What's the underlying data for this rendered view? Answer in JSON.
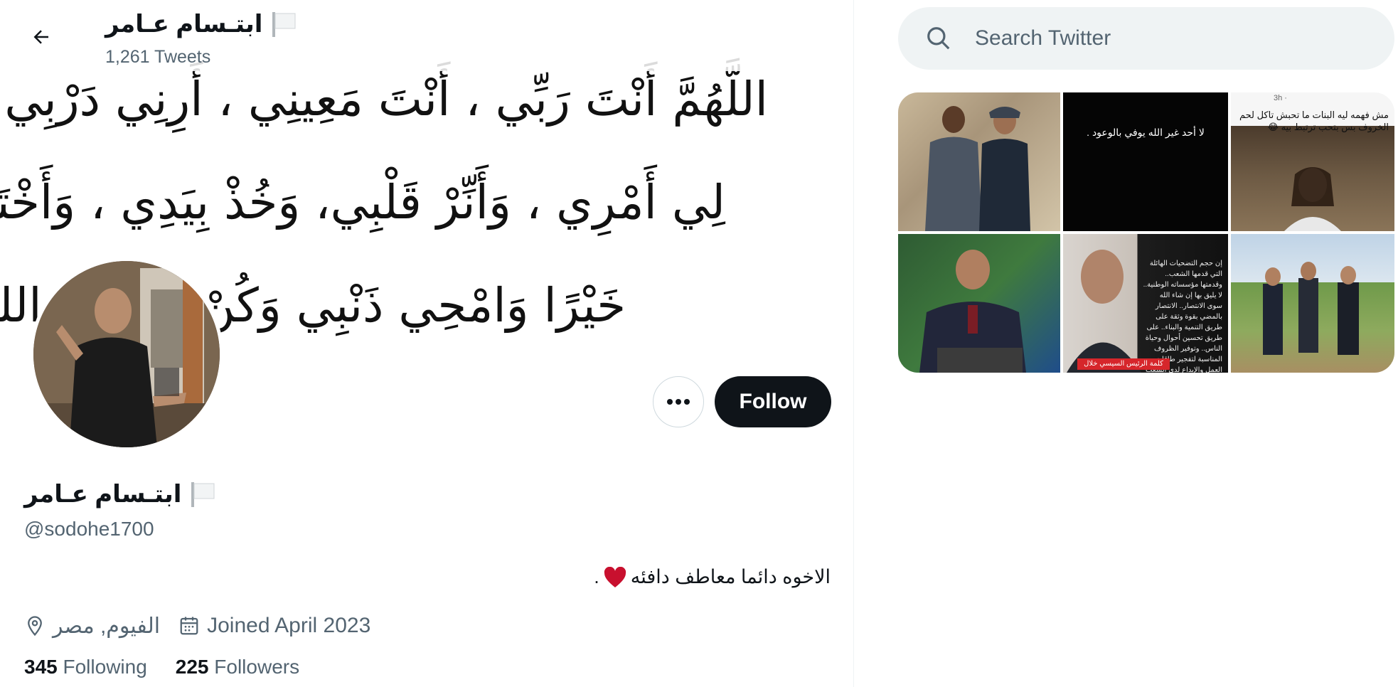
{
  "header": {
    "name": "ابتـسام عـامر",
    "tweet_count": "1,261 Tweets"
  },
  "banner": {
    "lines": [
      "اللَّهُمَّ أَنْتَ رَبِّي ، أَنْتَ مَعِينِي ، أَرِنِي دَرْبِي ، وَيَسِّرْ",
      "لِي أَمْرِي ، وَأَنِّرْ قَلْبِي، وَخُذْ بِيَدِي ، وَأَخْتَرْ لِي",
      "خَيْرًا وَامْحِي ذَنْبِي وَكُنْ مَعِي يَا الله"
    ]
  },
  "profile": {
    "display_name": "ابتـسام عـامر",
    "handle": "@sodohe1700",
    "bio": "الاخوه دائما معاطف دافئه",
    "bio_suffix": ".",
    "location": "الفيوم, مصر",
    "joined": "Joined April 2023",
    "following_count": "345",
    "following_label": "Following",
    "followers_count": "225",
    "followers_label": "Followers"
  },
  "actions": {
    "follow_label": "Follow",
    "more_label": "•••"
  },
  "search": {
    "placeholder": "Search Twitter"
  },
  "media": {
    "tile2_text": "لا أحد غير الله يوفي بالوعود .",
    "tile3_time": "3h ·",
    "tile3_text": "مش فهمه ليه البنات ما تحبش تاكل لحم الخروف بس بتحب ترتبط بيه 😂",
    "tile5_text": "إن حجم التضحيات الهائلة التي قدمها الشعب.. وقدمتها مؤسساته الوطنية.. لا يليق بها إن شاء الله سوى الانتصار.. الانتصار بالمضي بقوة وثقة على طريق التنمية والبناء.. على طريق تحسين أحوال وحياة الناس.. وتوفير الظروف المناسبة لتفجير طاقات العمل والإبداع لدى الشعب المصري.. بكل أطيافه وفئاته",
    "tile5_caption": "كلمة الرئيس السيسي خلال"
  },
  "colors": {
    "text_primary": "#0f1419",
    "text_secondary": "#536471",
    "follow_bg": "#0f1419",
    "search_bg": "#eff3f4",
    "heart": "#e0245e"
  },
  "icons": [
    "back-arrow-icon",
    "flag-icon",
    "more-icon",
    "location-icon",
    "calendar-icon",
    "search-icon",
    "heart-icon"
  ]
}
